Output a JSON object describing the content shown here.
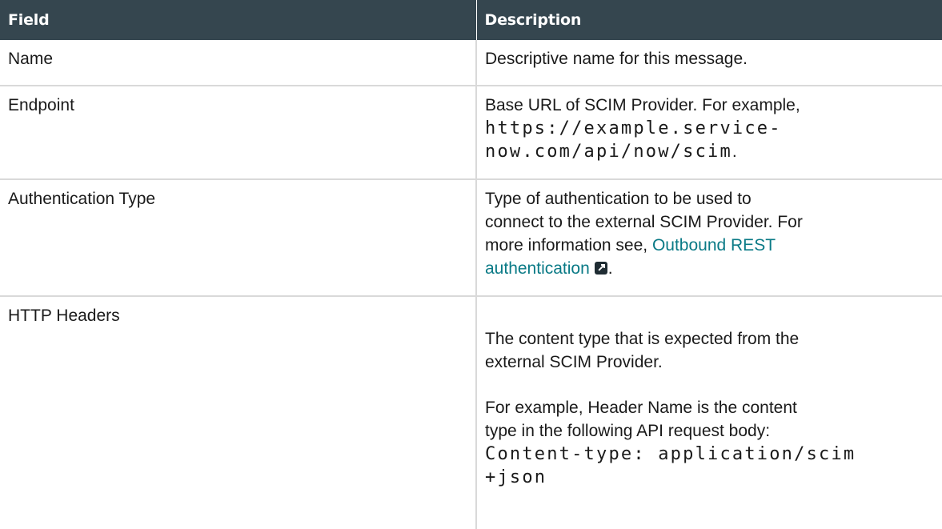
{
  "table": {
    "headers": {
      "field": "Field",
      "description": "Description"
    },
    "rows": {
      "name": {
        "field": "Name",
        "description": "Descriptive name for this message."
      },
      "endpoint": {
        "field": "Endpoint",
        "description_prefix": "Base URL of SCIM Provider. For example,",
        "code_line1": "https://example.service-",
        "code_line2": "now.com/api/now/scim",
        "description_suffix": "."
      },
      "auth": {
        "field": "Authentication Type",
        "description_line1": "Type of authentication to be used to",
        "description_line2": "connect to the external SCIM Provider. For",
        "description_line3": "more information see,",
        "link_line1": "Outbound REST",
        "link_line2": "authentication",
        "link_icon": "external-link-icon",
        "description_suffix": "."
      },
      "headers": {
        "field": "HTTP Headers",
        "para1_line1": "The content type that is expected from the",
        "para1_line2": "external SCIM Provider.",
        "para2_line1": "For example, Header Name is the content",
        "para2_line2": "type in the following API request body:",
        "code_line1": "Content-type: application/scim",
        "code_line2": "+json"
      }
    }
  },
  "colors": {
    "header_bg": "#35464f",
    "link": "#0a7a86",
    "border": "#d9d9d9"
  }
}
